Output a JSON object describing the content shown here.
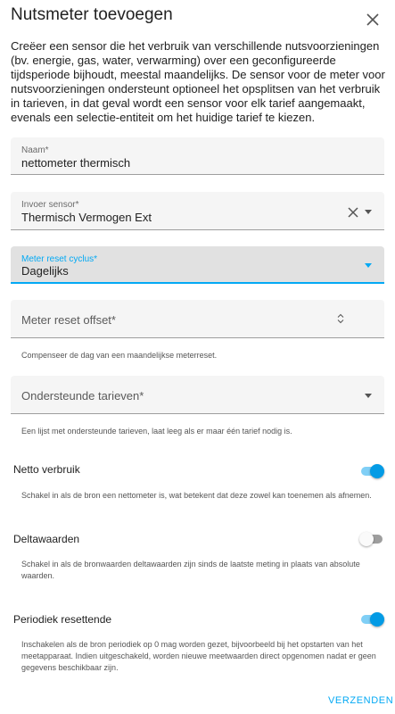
{
  "dialog": {
    "title": "Nutsmeter toevoegen",
    "intro": "Creëer een sensor die het verbruik van verschillende nutsvoorzieningen (bv. energie, gas, water, verwarming) over een geconfigureerde tijdsperiode bijhoudt, meestal maandelijks. De sensor voor de meter voor nutsvoorzieningen ondersteunt optioneel het opsplitsen van het verbruik in tarieven, in dat geval wordt een sensor voor elk tarief aangemaakt, evenals een selectie-entiteit om het huidige tarief te kiezen."
  },
  "fields": {
    "name": {
      "label": "Naam*",
      "value": "nettometer thermisch"
    },
    "input_sensor": {
      "label": "Invoer sensor*",
      "value": "Thermisch Vermogen Ext"
    },
    "reset_cycle": {
      "label": "Meter reset cyclus*",
      "value": "Dagelijks"
    },
    "reset_offset": {
      "placeholder": "Meter reset offset*",
      "helper": "Compenseer de dag van een maandelijkse meterreset."
    },
    "tariffs": {
      "placeholder": "Ondersteunde tarieven*",
      "helper": "Een lijst met ondersteunde tarieven, laat leeg als er maar één tarief nodig is."
    }
  },
  "toggles": {
    "net_consumption": {
      "label": "Netto verbruik",
      "on": true,
      "helper": "Schakel in als de bron een nettometer is, wat betekent dat deze zowel kan toenemen als afnemen."
    },
    "delta_values": {
      "label": "Deltawaarden",
      "on": false,
      "helper": "Schakel in als de bronwaarden deltawaarden zijn sinds de laatste meting in plaats van absolute waarden."
    },
    "periodic_reset": {
      "label": "Periodiek resettende",
      "on": true,
      "helper": "Inschakelen als de bron periodiek op 0 mag worden gezet, bijvoorbeeld bij het opstarten van het meetapparaat. Indien uitgeschakeld, worden nieuwe meetwaarden direct opgenomen nadat er geen gegevens beschikbaar zijn."
    }
  },
  "actions": {
    "submit_label": "VERZENDEN"
  },
  "colors": {
    "accent": "#03a9f4",
    "switch_on": "#039be5"
  }
}
